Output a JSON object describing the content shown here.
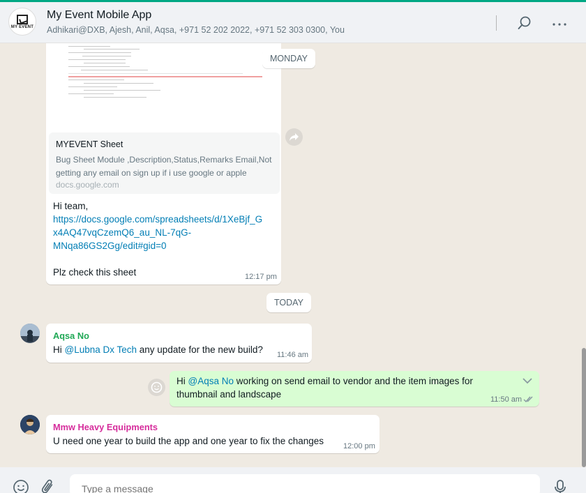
{
  "header": {
    "title": "My Event Mobile App",
    "participants": "Adhikari@DXB, Ajesh, Anil, Aqsa, +971 52 202 2022, +971 52 303 0300, You",
    "avatar_text": "MY EVENT",
    "icons": [
      "search-icon",
      "menu-icon"
    ]
  },
  "day_chips": {
    "monday": "MONDAY",
    "today": "TODAY"
  },
  "message1": {
    "preview_title": "MYEVENT Sheet",
    "preview_desc": "Bug Sheet Module ,Description,Status,Remarks Email,Not getting any email on sign up if i use google or apple",
    "preview_domain": "docs.google.com",
    "greeting": "Hi team,",
    "link_line1": "https://docs.google.com/spreadsheets/d/1XeBjf_G",
    "link_line2": "x4AQ47vqCzemQ6_au_NL-7qG-",
    "link_line3": "MNqa86GS2Gg/edit#gid=0",
    "body": "Plz check this sheet",
    "time": "12:17 pm"
  },
  "message2": {
    "sender": "Aqsa No",
    "sender_color": "#1fa855",
    "prefix": "Hi ",
    "mention": "@Lubna Dx Tech",
    "suffix": " any update for the new build?",
    "time": "11:46 am"
  },
  "message3": {
    "prefix": "Hi ",
    "mention": "@Aqsa No",
    "suffix_line1": " working on send email to vendor and the item images for",
    "line2": "thumbnail and landscape",
    "time": "11:50 am"
  },
  "message4": {
    "sender": "Mmw Heavy Equipments",
    "sender_color": "#d62d9c",
    "body": "U need one year to build the app and one year to fix the changes",
    "time": "12:00 pm"
  },
  "composer": {
    "placeholder": "Type a message",
    "icons": [
      "emoji-icon",
      "attach-icon",
      "mic-icon"
    ]
  }
}
